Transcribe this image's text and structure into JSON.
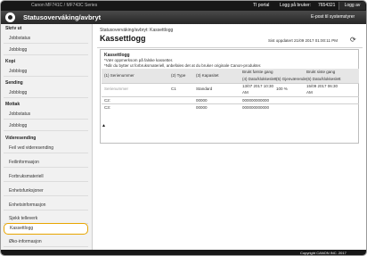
{
  "topbar": {
    "device": "Canon MF741C / MF743C Series",
    "mode": "TI portal",
    "user_label": "Logg på bruker:",
    "user_value": "7654321",
    "logout": "Logg av"
  },
  "header": {
    "title": "Statusoverváking/avbryt",
    "mail": "E-post til systemstyrer"
  },
  "sidebar": {
    "sections": [
      {
        "title": "Skriv ut",
        "items": [
          "Jobbstatus",
          "Jobblogg"
        ]
      },
      {
        "title": "Kopi",
        "items": [
          "Jobblogg"
        ]
      },
      {
        "title": "Sending",
        "items": [
          "Jobblogg"
        ]
      },
      {
        "title": "Mottak",
        "items": [
          "Jobbstatus",
          "Jobblogg"
        ]
      },
      {
        "title": "Videresending",
        "items": [
          "Feil ved videresending",
          "Feilinformasjon",
          "Forbruksmateriell",
          "Enhetsfunksjoner",
          "Enhetsinformasjon",
          "Sjekk telleverk",
          "Kassettlogg",
          "Øko-informasjon"
        ]
      }
    ]
  },
  "main": {
    "breadcrumb": "Statusoverváking/avbryt: Kassettlogg",
    "title": "Kassettlogg",
    "updated": "Sist oppdatert 21/09 2017 01:00:11 PM",
    "panel": {
      "title": "Kassettlogg",
      "notes": [
        "*Vær oppmerksom på falske kassetter.",
        "*Når du bytter ut forbruksmateriell, anbefales det at du bruker originale Canon-produkter."
      ],
      "headers": {
        "serial": "(1) Serienummer",
        "type": "(2) Type",
        "capacity": "(3) Kapasitet",
        "first_use": "Brukt første gang",
        "last_use": "Brukt siste gang",
        "date4": "(4) Dato/klokkeslett",
        "remaining": "(5) Gjenværende",
        "date6": "(6) Dato/klokkeslett"
      },
      "rows": [
        {
          "serial": "Serienummer",
          "type": "C1",
          "capacity": "Standard",
          "date4_a": "13/07 2017 10:30",
          "date4_b": "AM",
          "remaining": "100 %",
          "date6_a": "15/09 2017 06:30",
          "date6_b": "AM"
        },
        {
          "serial": "C2:",
          "type": "",
          "capacity": "00000",
          "date4_a": "000000000000",
          "date4_b": "",
          "remaining": "",
          "date6_a": "",
          "date6_b": ""
        },
        {
          "serial": "C3:",
          "type": "",
          "capacity": "00000",
          "date4_a": "000000000000",
          "date4_b": "",
          "remaining": "",
          "date6_a": "",
          "date6_b": ""
        }
      ]
    },
    "to_top": "▲"
  },
  "footer": {
    "copyright": "Copyright CANON INC. 2017"
  },
  "colors": {
    "dark": "#171717",
    "highlight": "#e8a500"
  },
  "icons": {
    "logo": "canon-logo-icon",
    "refresh": "refresh-icon",
    "top": "to-top-icon"
  }
}
